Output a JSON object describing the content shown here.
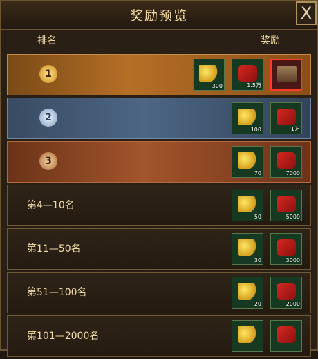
{
  "window": {
    "title": "奖励预览",
    "close_label": "X"
  },
  "headers": {
    "rank": "排名",
    "reward": "奖励"
  },
  "rows": [
    {
      "label": "1",
      "style": "gold",
      "items": [
        {
          "icon": "gold-ingots",
          "qty": "300"
        },
        {
          "icon": "red-gift-bag",
          "qty": "1.5万"
        },
        {
          "icon": "treasure-chest",
          "qty": ""
        }
      ]
    },
    {
      "label": "2",
      "style": "silver",
      "items": [
        {
          "icon": "gold-ingots",
          "qty": "100"
        },
        {
          "icon": "red-gift-bag",
          "qty": "1万"
        }
      ]
    },
    {
      "label": "3",
      "style": "bronze",
      "items": [
        {
          "icon": "gold-ingots",
          "qty": "70"
        },
        {
          "icon": "red-gift-bag",
          "qty": "7000"
        }
      ]
    },
    {
      "label": "第4—10名",
      "style": "plain",
      "items": [
        {
          "icon": "gold-ingots",
          "qty": "50"
        },
        {
          "icon": "red-gift-bag",
          "qty": "5000"
        }
      ]
    },
    {
      "label": "第11—50名",
      "style": "plain",
      "items": [
        {
          "icon": "gold-ingots",
          "qty": "30"
        },
        {
          "icon": "red-gift-bag",
          "qty": "3000"
        }
      ]
    },
    {
      "label": "第51—100名",
      "style": "plain",
      "items": [
        {
          "icon": "gold-ingots",
          "qty": "20"
        },
        {
          "icon": "red-gift-bag",
          "qty": "2000"
        }
      ]
    },
    {
      "label": "第101—2000名",
      "style": "plain",
      "items": [
        {
          "icon": "gold-ingots",
          "qty": ""
        },
        {
          "icon": "red-gift-bag",
          "qty": ""
        }
      ]
    }
  ]
}
